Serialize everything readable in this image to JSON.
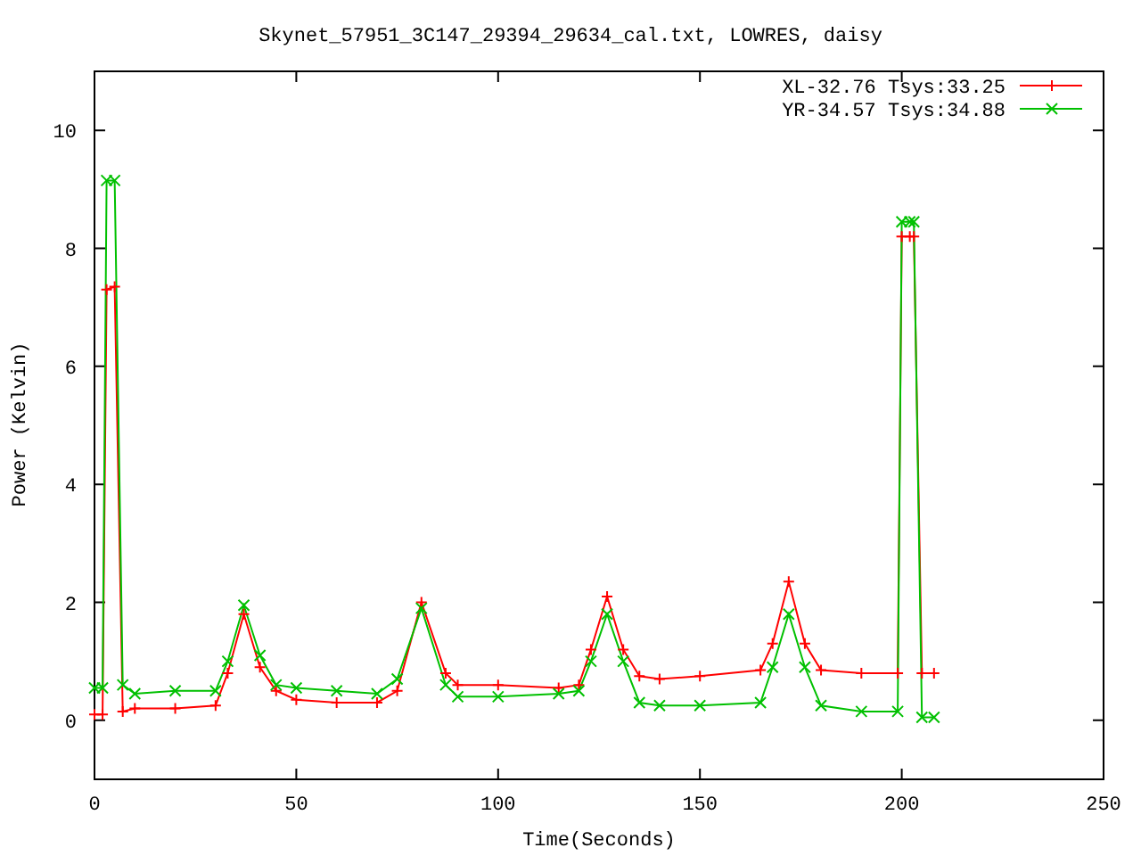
{
  "chart_data": {
    "type": "line",
    "title": "Skynet_57951_3C147_29394_29634_cal.txt, LOWRES, daisy",
    "xlabel": "Time(Seconds)",
    "ylabel": "Power (Kelvin)",
    "xlim": [
      0,
      250
    ],
    "ylim": [
      -1,
      11
    ],
    "xticks": [
      0,
      50,
      100,
      150,
      200,
      250
    ],
    "yticks": [
      0,
      2,
      4,
      6,
      8,
      10
    ],
    "legend": true,
    "x": [
      0,
      2,
      3,
      5,
      7,
      10,
      20,
      30,
      33,
      37,
      41,
      45,
      50,
      60,
      70,
      75,
      81,
      87,
      90,
      100,
      115,
      120,
      123,
      127,
      131,
      135,
      140,
      150,
      165,
      168,
      172,
      176,
      180,
      190,
      199,
      200,
      202,
      203,
      205,
      208
    ],
    "series": [
      {
        "name": "XL-32.76 Tsys:33.25",
        "color": "#ff0000",
        "marker": "plus",
        "values": [
          0.1,
          0.1,
          7.3,
          7.35,
          0.15,
          0.2,
          0.2,
          0.25,
          0.8,
          1.8,
          0.9,
          0.5,
          0.35,
          0.3,
          0.3,
          0.5,
          2.0,
          0.8,
          0.6,
          0.6,
          0.55,
          0.6,
          1.2,
          2.1,
          1.2,
          0.75,
          0.7,
          0.75,
          0.85,
          1.3,
          2.35,
          1.3,
          0.85,
          0.8,
          0.8,
          8.2,
          8.2,
          8.2,
          0.8,
          0.8
        ]
      },
      {
        "name": "YR-34.57 Tsys:34.88",
        "color": "#00c000",
        "marker": "cross",
        "values": [
          0.55,
          0.55,
          9.15,
          9.15,
          0.6,
          0.45,
          0.5,
          0.5,
          1.0,
          1.95,
          1.1,
          0.6,
          0.55,
          0.5,
          0.45,
          0.7,
          1.9,
          0.6,
          0.4,
          0.4,
          0.45,
          0.5,
          1.0,
          1.8,
          1.0,
          0.3,
          0.25,
          0.25,
          0.3,
          0.9,
          1.8,
          0.9,
          0.25,
          0.15,
          0.15,
          8.45,
          8.45,
          8.45,
          0.05,
          0.05
        ]
      }
    ]
  }
}
